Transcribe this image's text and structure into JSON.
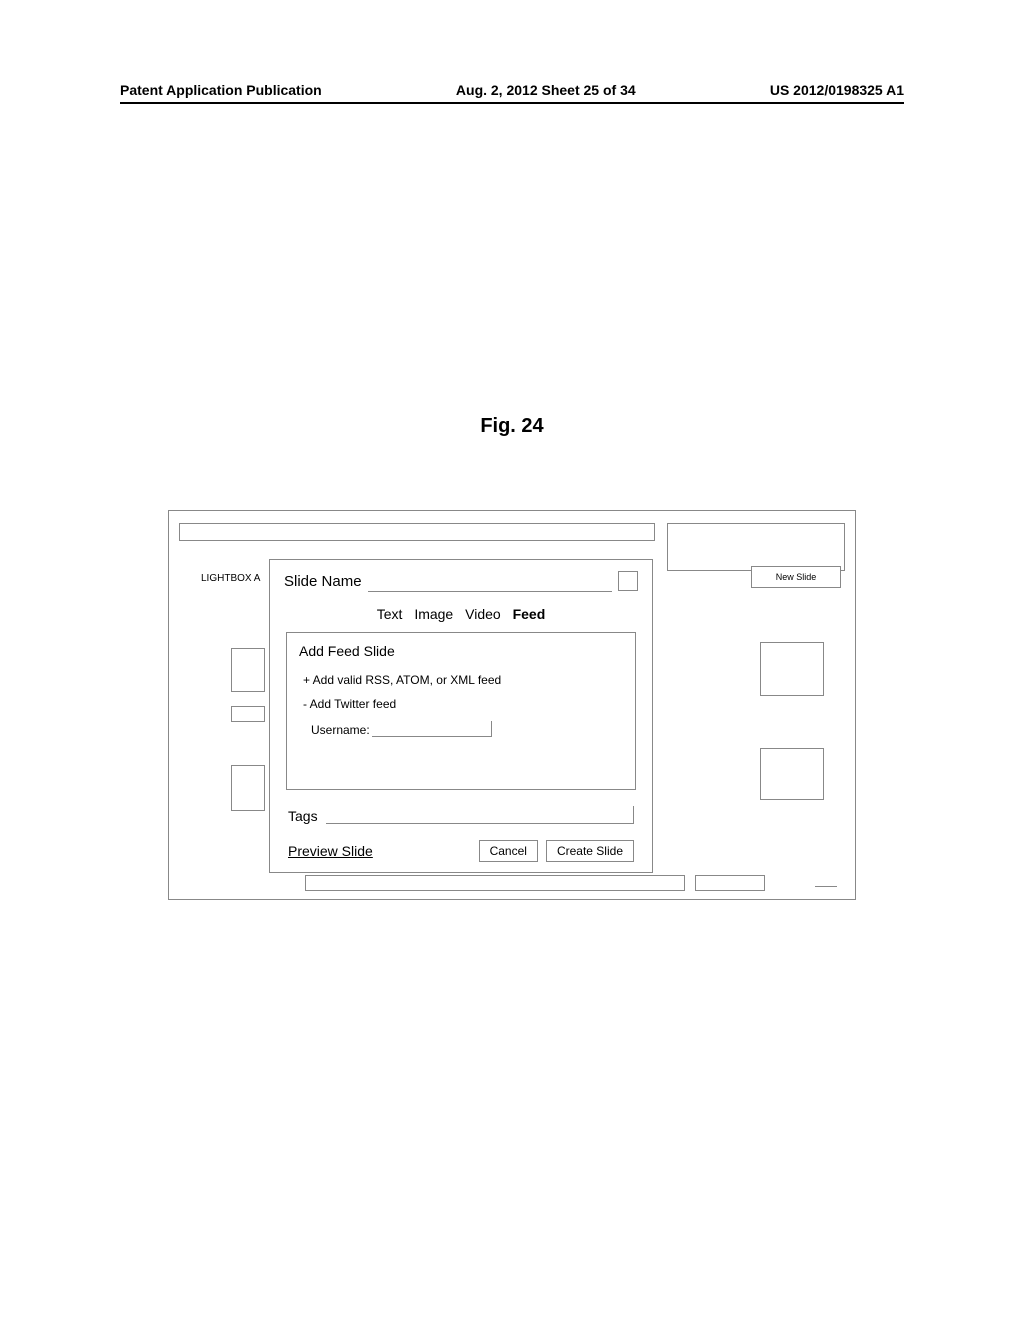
{
  "header": {
    "left": "Patent Application Publication",
    "center": "Aug. 2, 2012  Sheet 25 of 34",
    "right": "US 2012/0198325 A1"
  },
  "figure_label": "Fig. 24",
  "app": {
    "lightbox_label": "LIGHTBOX A",
    "new_slide_button": "New Slide"
  },
  "modal": {
    "slide_name_label": "Slide Name",
    "slide_name_value": "",
    "tabs": {
      "text": "Text",
      "image": "Image",
      "video": "Video",
      "feed": "Feed"
    },
    "feed_panel": {
      "title": "Add Feed Slide",
      "add_rss": "+   Add valid RSS, ATOM, or XML feed",
      "add_twitter": "-   Add Twitter feed",
      "username_label": "Username:",
      "username_value": ""
    },
    "tags_label": "Tags",
    "tags_value": "",
    "preview_link": "Preview Slide",
    "cancel_button": "Cancel",
    "create_button": "Create Slide"
  }
}
